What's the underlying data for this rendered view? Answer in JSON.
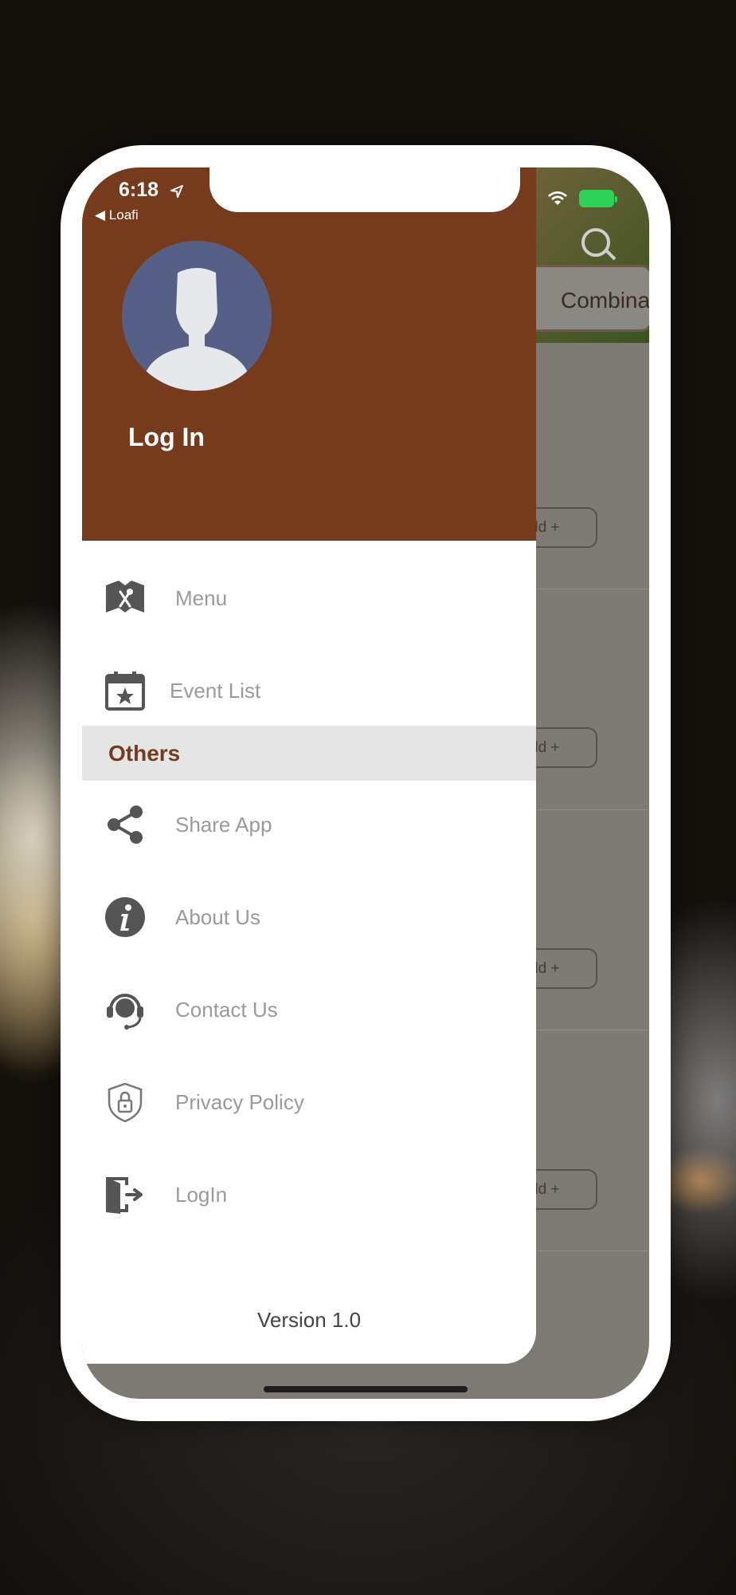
{
  "status_bar": {
    "time": "6:18",
    "back_app": "◀ Loafi"
  },
  "background_app": {
    "category_tab": "Combinat",
    "add_buttons": [
      "dd +",
      "dd +",
      "dd +",
      "dd +"
    ]
  },
  "drawer": {
    "header_title": "Log In",
    "items": [
      {
        "label": "Menu",
        "icon": "restaurant-menu-icon"
      },
      {
        "label": "Event List",
        "icon": "calendar-star-icon"
      }
    ],
    "section_title": "Others",
    "others": [
      {
        "label": "Share App",
        "icon": "share-icon"
      },
      {
        "label": "About Us",
        "icon": "info-icon"
      },
      {
        "label": "Contact Us",
        "icon": "headset-icon"
      },
      {
        "label": "Privacy Policy",
        "icon": "shield-lock-icon"
      },
      {
        "label": "LogIn",
        "icon": "login-door-icon"
      }
    ],
    "version": "Version 1.0"
  },
  "colors": {
    "header_brown": "#763a1c",
    "avatar_blue": "#566087",
    "icon_gray": "#555555",
    "label_gray": "#9a9a9a"
  }
}
